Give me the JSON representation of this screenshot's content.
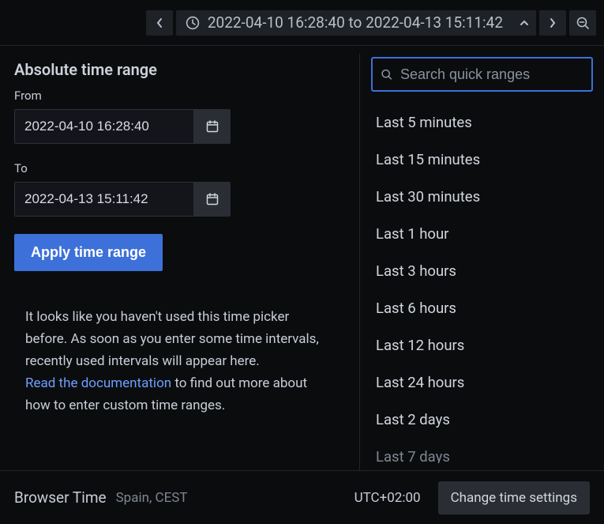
{
  "toolbar": {
    "range_text": "2022-04-10 16:28:40 to 2022-04-13 15:11:42"
  },
  "absolute": {
    "title": "Absolute time range",
    "from_label": "From",
    "from_value": "2022-04-10 16:28:40",
    "to_label": "To",
    "to_value": "2022-04-13 15:11:42",
    "apply_label": "Apply time range"
  },
  "help": {
    "text1": "It looks like you haven't used this time picker before. As soon as you enter some time intervals, recently used intervals will appear here.",
    "link": "Read the documentation",
    "text2": " to find out more about how to enter custom time ranges."
  },
  "search": {
    "placeholder": "Search quick ranges"
  },
  "quick_ranges": [
    "Last 5 minutes",
    "Last 15 minutes",
    "Last 30 minutes",
    "Last 1 hour",
    "Last 3 hours",
    "Last 6 hours",
    "Last 12 hours",
    "Last 24 hours",
    "Last 2 days",
    "Last 7 days"
  ],
  "footer": {
    "browser_time_label": "Browser Time",
    "locale": "Spain, CEST",
    "utc_offset": "UTC+02:00",
    "change_label": "Change time settings"
  }
}
